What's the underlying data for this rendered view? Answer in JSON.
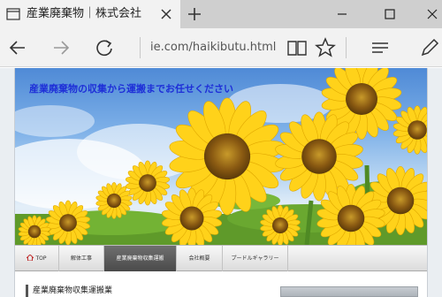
{
  "browser": {
    "tab": {
      "title": "産業廃棄物｜株式会社"
    },
    "address_bar": {
      "url": "ie.com/haikibutu.html"
    }
  },
  "page": {
    "hero": {
      "tagline": "産業廃棄物の収集から運搬までお任せください"
    },
    "nav": {
      "items": [
        {
          "label": "TOP",
          "active": false
        },
        {
          "label": "解体工事",
          "active": false
        },
        {
          "label": "産業廃棄物収集運搬",
          "active": true
        },
        {
          "label": "会社概要",
          "active": false
        },
        {
          "label": "プードルギャラリー",
          "active": false
        }
      ]
    },
    "content": {
      "section_heading": "産業廃棄物収集運搬業"
    }
  },
  "colors": {
    "tagline": "#1e2fd8",
    "nav_active": "#555555",
    "sunflower_petal": "#ffd21a",
    "sunflower_center": "#8a5a12"
  }
}
